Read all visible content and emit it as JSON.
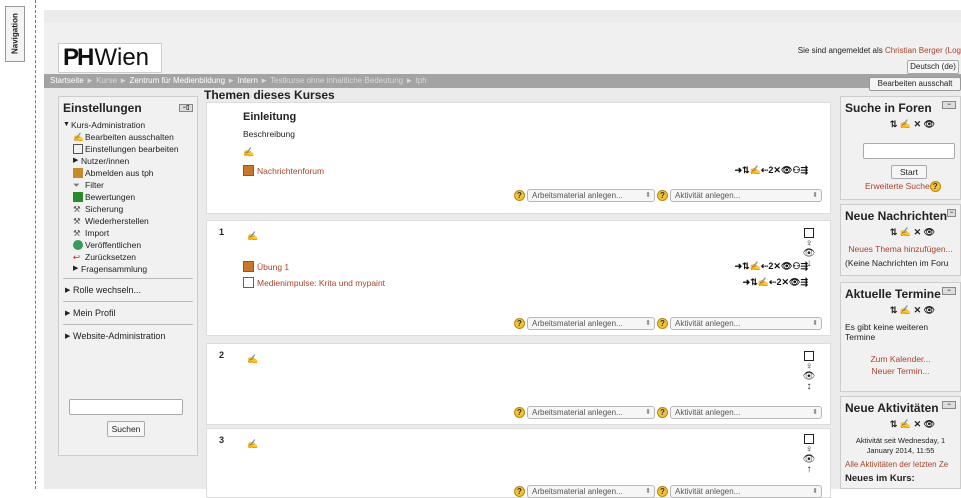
{
  "nav_tab": "Navigation",
  "header": {
    "logo_ph": "PH",
    "logo_wien": "Wien",
    "login_prefix": "Sie sind angemeldet als ",
    "login_user": "Christian Berger",
    "login_suffix": " (Log",
    "lang_button": "Deutsch (de)"
  },
  "breadcrumb": {
    "items": [
      "Startseite",
      "Kurse",
      "Zentrum für Medienbildung",
      "Intern",
      "Testkurse ohne inhaltliche Bedeutung",
      "tph"
    ],
    "sep": " ► "
  },
  "edit_button": "Bearbeiten ausschalt",
  "settings": {
    "title": "Einstellungen",
    "course_admin": "Kurs-Administration",
    "items": [
      {
        "label": "Bearbeiten ausschalten",
        "icon": "pencil-icon"
      },
      {
        "label": "Einstellungen bearbeiten",
        "icon": "settings-icon"
      },
      {
        "label": "Nutzer/innen",
        "icon": "expand-icon"
      },
      {
        "label": "Abmelden aus tph",
        "icon": "unenrol-icon"
      },
      {
        "label": "Filter",
        "icon": "filter-icon"
      },
      {
        "label": "Bewertungen",
        "icon": "grades-icon"
      },
      {
        "label": "Sicherung",
        "icon": "backup-icon"
      },
      {
        "label": "Wiederherstellen",
        "icon": "restore-icon"
      },
      {
        "label": "Import",
        "icon": "import-icon"
      },
      {
        "label": "Veröffentlichen",
        "icon": "publish-icon"
      },
      {
        "label": "Zurücksetzen",
        "icon": "reset-icon"
      },
      {
        "label": "Fragensammlung",
        "icon": "expand-icon"
      }
    ],
    "role_switch": "Rolle wechseln...",
    "profile": "Mein Profil",
    "site_admin": "Website-Administration",
    "search_button": "Suchen"
  },
  "main": {
    "title": "Themen dieses Kurses",
    "intro_title": "Einleitung",
    "intro_desc": "Beschreibung",
    "forum_link": "Nachrichtenforum",
    "add_resource": "Arbeitsmaterial anlegen...",
    "add_activity": "Aktivität anlegen...",
    "section_numbers": [
      "1",
      "2",
      "3"
    ],
    "section1_items": [
      "Übung 1",
      "Medienimpulse: Krita und mypaint"
    ],
    "tools_full": "➜⇅✍⇠2✕👁⚇⇶",
    "tools_short": "➜⇅✍⇠2✕👁⇶"
  },
  "forum_search": {
    "title": "Suche in Foren",
    "start_button": "Start",
    "advanced": "Erweiterte Suche"
  },
  "news": {
    "title": "Neue Nachrichten",
    "add_topic": "Neues Thema hinzufügen...",
    "none": "(Keine Nachrichten im Foru"
  },
  "events": {
    "title": "Aktuelle Termine",
    "none": "Es gibt keine weiteren Termine",
    "calendar": "Zum Kalender...",
    "new_event": "Neuer Termin..."
  },
  "activity": {
    "title": "Neue Aktivitäten",
    "since": "Aktivität seit Wednesday, 1 January 2014, 11:55",
    "all": "Alle Aktivitäten der letzten Ze",
    "new_in_course": "Neues im Kurs:"
  },
  "block_tools": "⇅ ✍ ✕ 👁",
  "colors": {
    "link": "#a8452b",
    "breadcrumb_bar": "#a3a3a3",
    "help_icon": "#f2c23c"
  }
}
